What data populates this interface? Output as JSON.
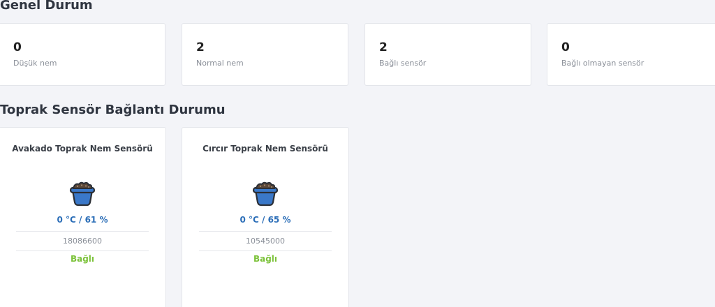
{
  "overview": {
    "title": "Genel Durum",
    "stats": [
      {
        "value": "0",
        "label": "Düşük nem"
      },
      {
        "value": "2",
        "label": "Normal nem"
      },
      {
        "value": "2",
        "label": "Bağlı sensör"
      },
      {
        "value": "0",
        "label": "Bağlı olmayan sensör"
      }
    ]
  },
  "sensors_section": {
    "title": "Toprak Sensör Bağlantı Durumu",
    "sensors": [
      {
        "name": "Avakado Toprak Nem Sensörü",
        "icon": "plant-pot-icon",
        "reading": "0 °C / 61 %",
        "id": "18086600",
        "status": "Bağlı"
      },
      {
        "name": "Cırcır Toprak Nem Sensörü",
        "icon": "plant-pot-icon",
        "reading": "0 °C / 65 %",
        "id": "10545000",
        "status": "Bağlı"
      }
    ]
  },
  "colors": {
    "reading": "#2d6fb8",
    "status_connected": "#7cc23a",
    "pot_body": "#3a78c9",
    "soil": "#5b4636"
  }
}
